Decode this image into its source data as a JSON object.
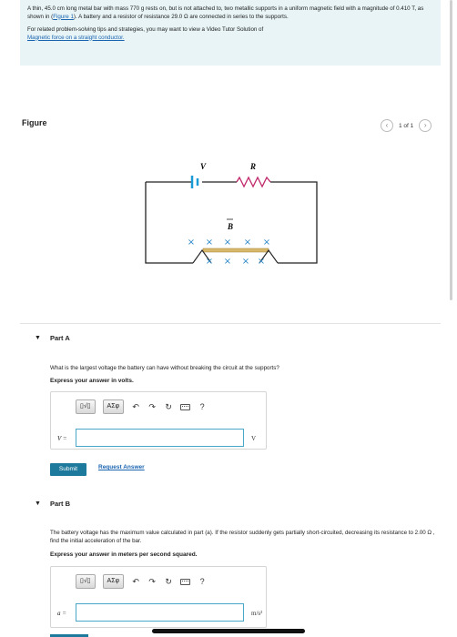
{
  "intro": {
    "problem_part1": "A thin, 45.0 cm long metal bar with mass 770 g rests on, but is not attached to, two metallic supports in a uniform magnetic field with a magnitude of 0.410 T, as shown in (",
    "figure_link": "Figure 1",
    "problem_part2": "). A battery and a resistor of resistance 29.0 Ω are connected in series to the supports.",
    "related_text": "For related problem-solving tips and strategies, you may want to view a Video Tutor Solution of",
    "related_link": "Magnetic force on a straight conductor."
  },
  "figure": {
    "title": "Figure",
    "counter": "1 of 1",
    "prev_icon": "‹",
    "next_icon": "›",
    "labels": {
      "battery": "V",
      "resistor": "R",
      "field": "B"
    },
    "field_marks": [
      "×",
      "×",
      "×",
      "×",
      "×",
      "×",
      "×",
      "×",
      "×"
    ]
  },
  "partA": {
    "title": "Part A",
    "question": "What is the largest voltage the battery can have without breaking the circuit at the supports?",
    "instruction": "Express your answer in volts.",
    "var_label": "V =",
    "value": "",
    "unit": "V",
    "submit": "Submit",
    "request": "Request Answer"
  },
  "partB": {
    "title": "Part B",
    "question": "The battery voltage has the maximum value calculated in part (a). If the resistor suddenly gets partially short-circuited, decreasing its resistance to 2.00 Ω , find the initial acceleration of the bar.",
    "instruction": "Express your answer in meters per second squared.",
    "var_label": "a =",
    "value": "",
    "unit": "m/s²"
  },
  "toolbar": {
    "templates": "▯√▯",
    "symbols": "ΑΣφ",
    "undo": "↶",
    "redo": "↷",
    "reset": "↻",
    "keyboard": "keyboard-icon",
    "help": "?"
  },
  "colors": {
    "intro_bg": "#e8f4f6",
    "link": "#1a64b0",
    "submit_bg": "#1d7a9c",
    "input_border": "#4aa6c8",
    "battery": "#1a9bd7",
    "resistor": "#c0286a",
    "bar": "#d8b86a",
    "field_x": "#2c88c7"
  }
}
